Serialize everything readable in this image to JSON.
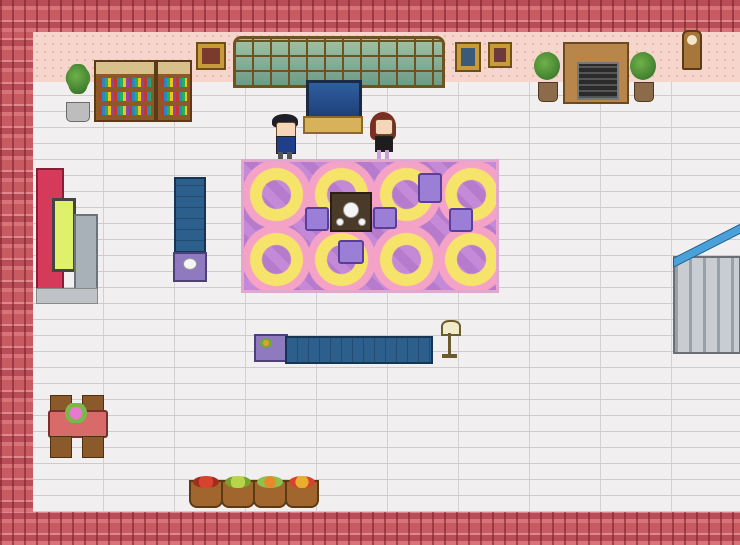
{
  "scene": {
    "type": "top-down pixel art room",
    "room": "living room"
  },
  "characters": [
    {
      "id": "player",
      "hair_color": "#1e1e28",
      "outfit_color": "#1f3f8a"
    },
    {
      "id": "npc",
      "hair_color": "#7a2f22",
      "outfit_color": "#1d1d1d"
    }
  ],
  "colors": {
    "roof": "#c85a62",
    "wall": "#f6d6cc",
    "floor": "#f1efef",
    "rug": "#c48ad8",
    "sofa": "#2d5f8c",
    "tv": "#d53a5a"
  },
  "objects": [
    "potted-palm",
    "bookshelf",
    "picture-frame",
    "large-window",
    "aquarium",
    "potted-tree",
    "fireplace",
    "wall-clock",
    "rug",
    "coffee-table",
    "tea-set",
    "cushions",
    "armchair",
    "side-table",
    "television",
    "sofa",
    "floor-lamp",
    "dining-table",
    "fruit-baskets",
    "staircase"
  ]
}
